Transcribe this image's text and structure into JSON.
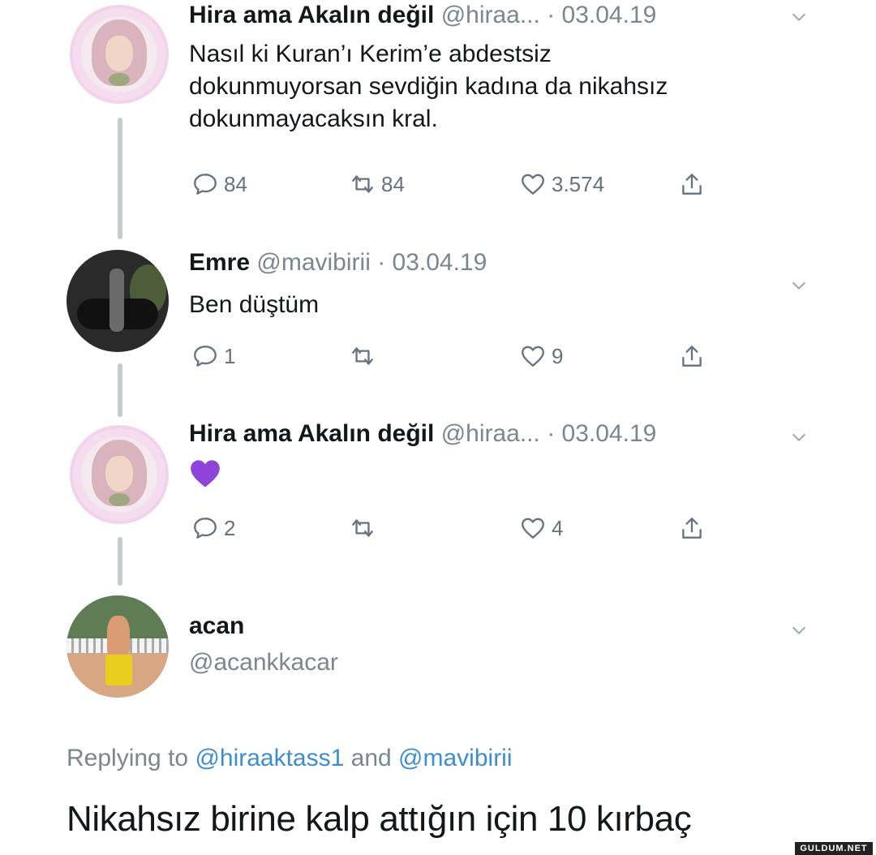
{
  "tweets": [
    {
      "author_name": "Hira ama Akalın değil",
      "handle": "@hiraa...",
      "date_sep": " · ",
      "date": "03.04.19",
      "text_lines": [
        "Nasıl ki Kuran’ı Kerim’e abdestsiz",
        "dokunmuyorsan sevdiğin kadına da nikahsız",
        "dokunmayacaksın kral."
      ],
      "replies": "84",
      "retweets": "84",
      "likes": "3.574"
    },
    {
      "author_name": "Emre",
      "handle": "@mavibirii",
      "date_sep": " · ",
      "date": "03.04.19",
      "text": "Ben düştüm",
      "replies": "1",
      "retweets": "",
      "likes": "9"
    },
    {
      "author_name": "Hira ama Akalın değil",
      "handle": "@hiraa...",
      "date_sep": " · ",
      "date": "03.04.19",
      "emoji": "purple-heart",
      "replies": "2",
      "retweets": "",
      "likes": "4"
    }
  ],
  "reply": {
    "author_name": "acan",
    "handle": "@acankkacar",
    "replying_prefix": "Replying to ",
    "mention1": "@hiraaktass1",
    "and_word": " and ",
    "mention2": "@mavibirii",
    "text": "Nikahsız birine kalp attığın için 10 kırbaç"
  },
  "watermark": "GULDUM.NET",
  "colors": {
    "text": "#14171a",
    "muted": "#7a8690",
    "link": "#3d8ed1",
    "thread_line": "#c7ccd1",
    "purple_heart": "#8e44d8"
  }
}
